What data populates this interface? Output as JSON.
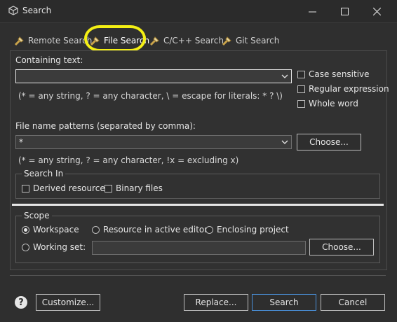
{
  "window": {
    "title": "Search",
    "minimize": "—",
    "maximize": "☐",
    "close": "✕"
  },
  "tabs": [
    {
      "label": "Remote Search",
      "active": false
    },
    {
      "label": "File Search",
      "active": true
    },
    {
      "label": "C/C++ Search",
      "active": false
    },
    {
      "label": "Git Search",
      "active": false
    }
  ],
  "containing": {
    "label": "Containing text:",
    "value": "",
    "hint": "(* = any string, ? = any character, \\ = escape for literals: * ? \\)",
    "options": [
      "Case sensitive",
      "Regular expression",
      "Whole word"
    ]
  },
  "patterns": {
    "label": "File name patterns (separated by comma):",
    "value": "*",
    "hint": "(* = any string, ? = any character, !x = excluding x)",
    "choose": "Choose..."
  },
  "search_in": {
    "title": "Search In",
    "options": [
      "Derived resources",
      "Binary files"
    ]
  },
  "scope": {
    "title": "Scope",
    "workspace": "Workspace",
    "active_editor": "Resource in active editor",
    "enclosing": "Enclosing project",
    "working_set": "Working set:",
    "choose": "Choose..."
  },
  "footer": {
    "customize": "Customize...",
    "replace": "Replace...",
    "search": "Search",
    "cancel": "Cancel",
    "help": "?"
  }
}
